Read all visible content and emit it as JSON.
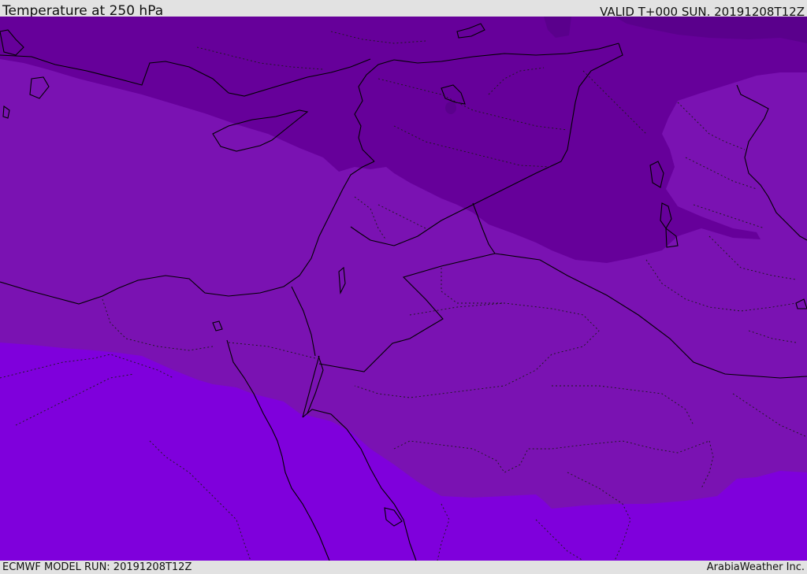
{
  "header": {
    "title": "Temperature at 250 hPa",
    "valid_time": "VALID T+000 SUN. 20191208T12Z"
  },
  "footer": {
    "model_run": "ECMWF MODEL RUN: 20191208T12Z",
    "credit": "ArabiaWeather Inc."
  },
  "map": {
    "field": "temperature",
    "level": "250 hPa",
    "colors": {
      "coldest": "#5a008c",
      "cold": "#66009a",
      "mid": "#7a12b2",
      "warm": "#7f00dc",
      "coastline": "#000000",
      "borders": "#1a1a1a"
    }
  }
}
